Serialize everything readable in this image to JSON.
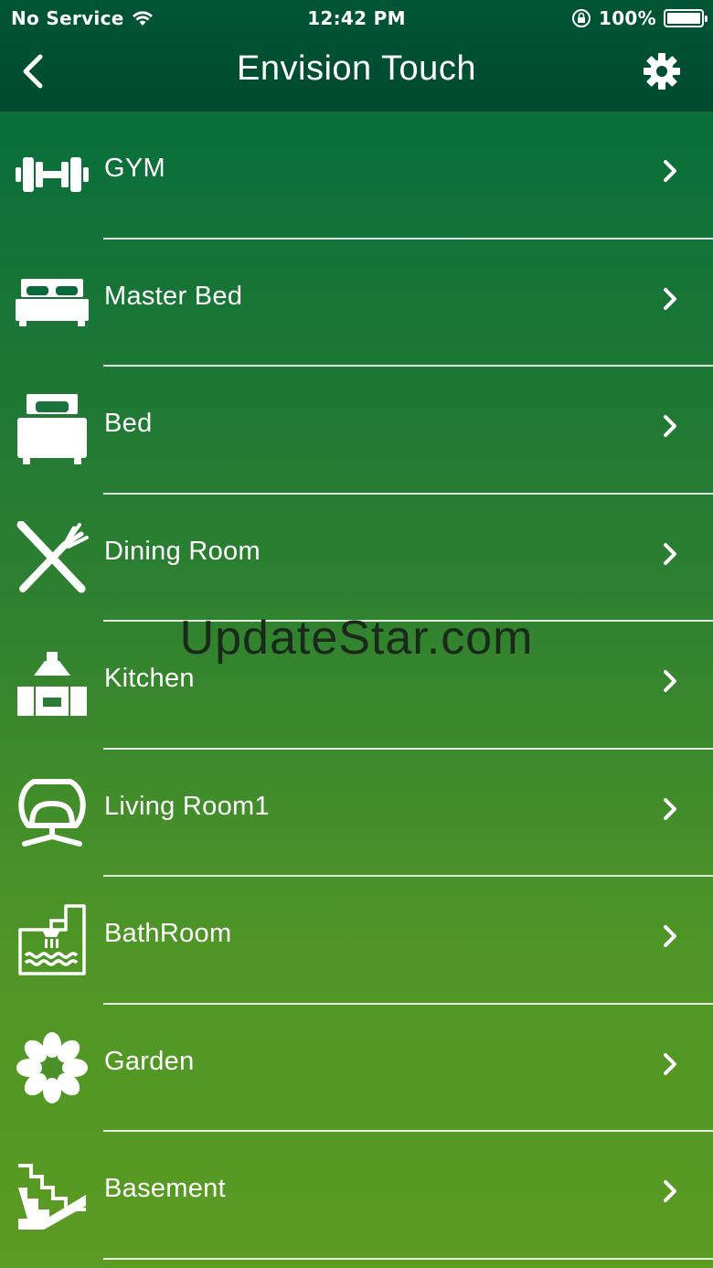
{
  "status_bar": {
    "carrier": "No Service",
    "time": "12:42 PM",
    "battery": "100%"
  },
  "nav": {
    "title": "Envision Touch"
  },
  "rooms": [
    {
      "label": "GYM",
      "icon": "dumbbell-icon"
    },
    {
      "label": "Master Bed",
      "icon": "double-bed-icon"
    },
    {
      "label": "Bed",
      "icon": "single-bed-icon"
    },
    {
      "label": "Dining Room",
      "icon": "knife-fork-icon"
    },
    {
      "label": "Kitchen",
      "icon": "kitchen-hood-icon"
    },
    {
      "label": "Living Room1",
      "icon": "armchair-icon"
    },
    {
      "label": "BathRoom",
      "icon": "shower-icon"
    },
    {
      "label": "Garden",
      "icon": "flower-icon"
    },
    {
      "label": "Basement",
      "icon": "stairs-icon"
    }
  ],
  "watermark": "UpdateStar.com",
  "colors": {
    "header": "#004f31",
    "gradient_top": "#006a3d",
    "gradient_bottom": "#5a9b22",
    "foreground": "#ffffff"
  }
}
